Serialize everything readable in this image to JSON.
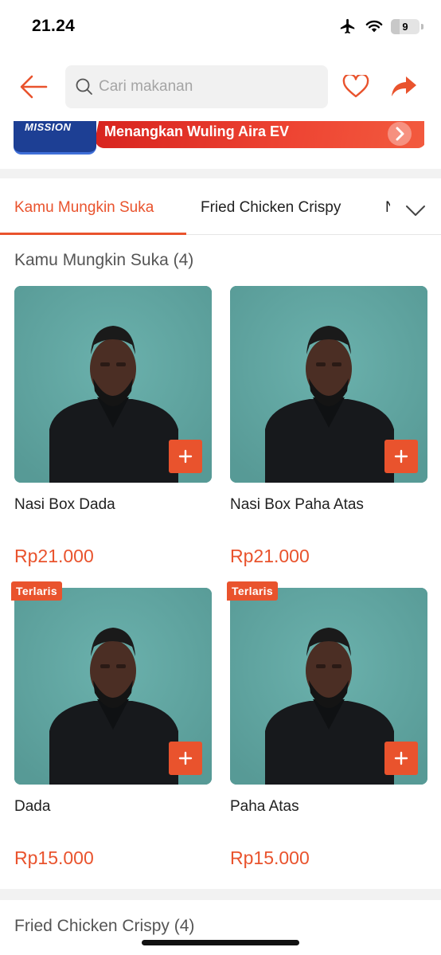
{
  "status_bar": {
    "time": "21.24",
    "battery_level": "9"
  },
  "header": {
    "search_placeholder": "Cari makanan",
    "icons": [
      "back-arrow-icon",
      "search-icon",
      "heart-icon",
      "share-icon"
    ]
  },
  "banner": {
    "logo_text": "MISSION",
    "text": "Menangkan Wuling Aira EV"
  },
  "tabs": [
    {
      "label": "Kamu Mungkin Suka",
      "active": true
    },
    {
      "label": "Fried Chicken Crispy",
      "active": false
    },
    {
      "label": "N",
      "active": false
    }
  ],
  "sections": [
    {
      "title": "Kamu Mungkin Suka (4)",
      "items": [
        {
          "name": "Nasi Box Dada",
          "price": "Rp21.000",
          "badge": ""
        },
        {
          "name": "Nasi Box Paha Atas",
          "price": "Rp21.000",
          "badge": ""
        },
        {
          "name": "Dada",
          "price": "Rp15.000",
          "badge": "Terlaris"
        },
        {
          "name": "Paha Atas",
          "price": "Rp15.000",
          "badge": "Terlaris"
        }
      ]
    },
    {
      "title": "Fried Chicken Crispy (4)"
    }
  ],
  "colors": {
    "accent": "#e9532d",
    "banner_red": "#e63b2c",
    "banner_blue": "#1d3f94",
    "photo_bg": "#65aaa6"
  }
}
